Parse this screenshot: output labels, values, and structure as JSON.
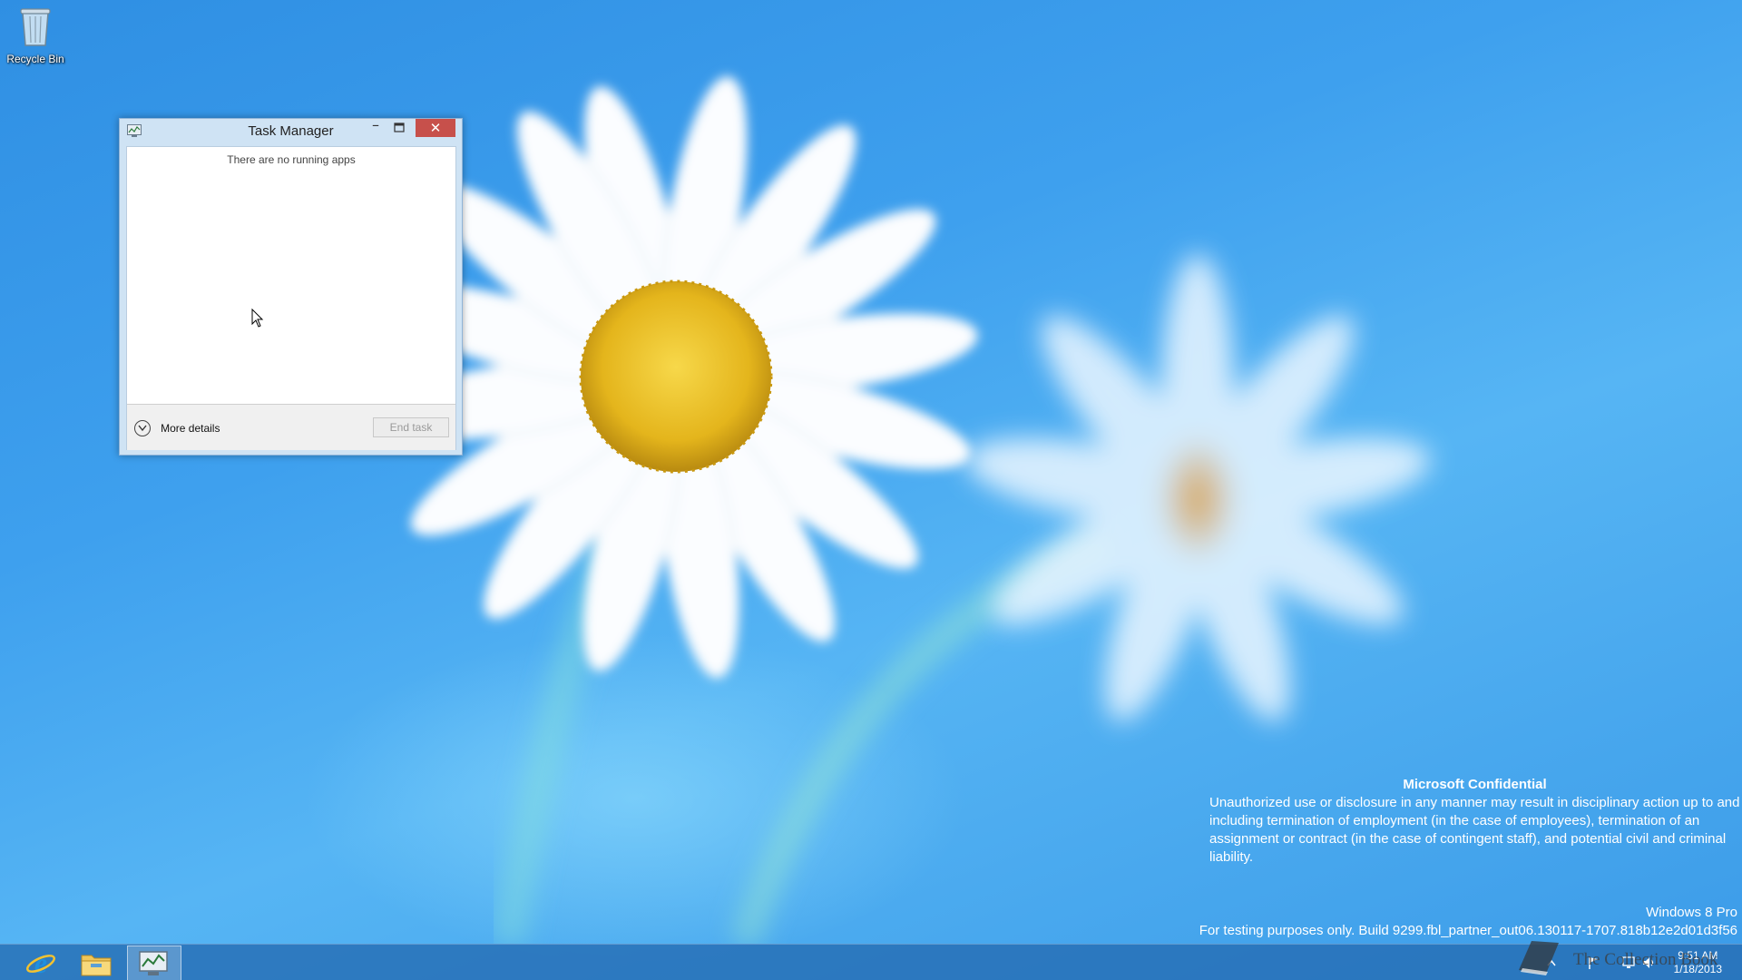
{
  "desktop": {
    "icons": [
      {
        "label": "Recycle Bin",
        "icon": "recycle-bin-icon"
      }
    ]
  },
  "task_manager": {
    "title": "Task Manager",
    "empty_message": "There are no running apps",
    "more_details_label": "More details",
    "end_task_label": "End task",
    "close_glyph": "✕",
    "minimize_glyph": "–"
  },
  "confidential": {
    "title": "Microsoft Confidential",
    "body": "Unauthorized use or disclosure in any manner may result in disciplinary action up to and including termination of employment (in the case of employees), termination of an assignment or contract (in the case of contingent staff), and potential civil and criminal liability."
  },
  "edition": {
    "name": "Windows 8 Pro",
    "build": "For testing purposes only. Build 9299.fbl_partner_out06.130117-1707.818b12e2d01d3f56"
  },
  "taskbar": {
    "pinned": [
      {
        "name": "Internet Explorer",
        "icon": "internet-explorer-icon"
      },
      {
        "name": "File Explorer",
        "icon": "file-explorer-icon"
      },
      {
        "name": "Task Manager",
        "icon": "task-manager-icon",
        "active": true
      }
    ],
    "clock_time": "9:51 AM",
    "clock_date": "1/18/2013",
    "watermark": "The Collection Book"
  },
  "colors": {
    "close_button": "#c7504b",
    "desktop_blue": "#3ea0ee",
    "taskbar": "#266eb4"
  }
}
